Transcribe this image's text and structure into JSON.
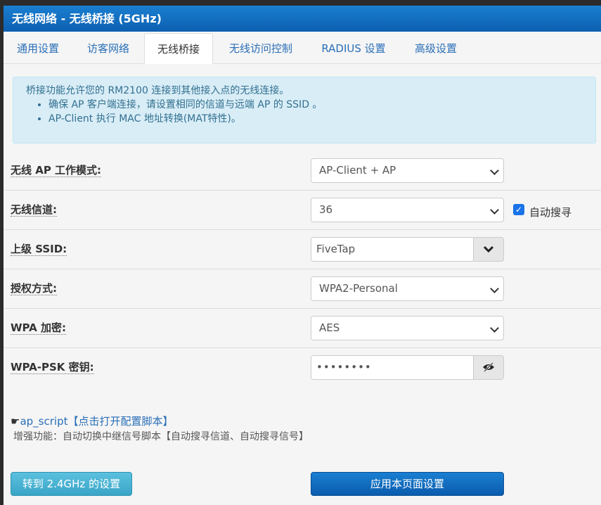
{
  "header": {
    "title": "无线网络 - 无线桥接 (5GHz)"
  },
  "tabs": [
    {
      "label": "通用设置"
    },
    {
      "label": "访客网络"
    },
    {
      "label": "无线桥接"
    },
    {
      "label": "无线访问控制"
    },
    {
      "label": "RADIUS 设置"
    },
    {
      "label": "高级设置"
    }
  ],
  "active_tab": 2,
  "alert": {
    "intro": "桥接功能允许您的 RM2100 连接到其他接入点的无线连接。",
    "bullets": [
      "确保 AP 客户端连接，请设置相同的信道与远端 AP 的 SSID 。",
      "AP-Client 执行 MAC 地址转换(MAT特性)。"
    ]
  },
  "form": {
    "mode": {
      "label": "无线 AP 工作模式:",
      "value": "AP-Client + AP"
    },
    "channel": {
      "label": "无线信道:",
      "value": "36",
      "auto_label": "自动搜寻",
      "auto_checked": true
    },
    "ssid": {
      "label": "上级 SSID:",
      "value": "FiveTap"
    },
    "auth": {
      "label": "授权方式:",
      "value": "WPA2-Personal"
    },
    "encryption": {
      "label": "WPA 加密:",
      "value": "AES"
    },
    "psk": {
      "label": "WPA-PSK 密钥:",
      "value": "••••••••"
    }
  },
  "script": {
    "link_icon": "☛",
    "link_text": "ap_script【点击打开配置脚本】",
    "note": "增强功能：自动切换中继信号脚本【自动搜寻信道、自动搜寻信号】"
  },
  "buttons": {
    "switch_band": "转到 2.4GHz 的设置",
    "apply": "应用本页面设置"
  },
  "colors": {
    "header": "#0d5fb0",
    "link": "#2a6fb7",
    "alert_bg": "#d9edf7"
  }
}
